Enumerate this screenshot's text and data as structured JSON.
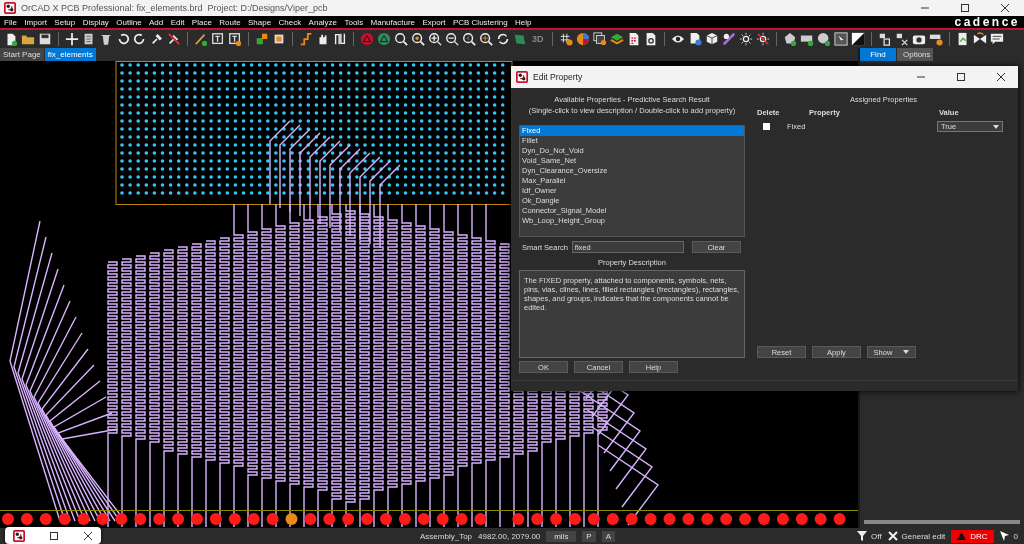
{
  "window": {
    "title": "OrCAD X PCB Professional: fix_elements.brd  Project: D:/Designs/Viper_pcb"
  },
  "menu": [
    "File",
    "Import",
    "Setup",
    "Display",
    "Outline",
    "Add",
    "Edit",
    "Place",
    "Route",
    "Shape",
    "Check",
    "Analyze",
    "Tools",
    "Manufacture",
    "Export",
    "PCB Clustering",
    "Help"
  ],
  "brand": "cadence",
  "toolbar": {
    "view_3d_button": "3D"
  },
  "doc_tabs": [
    {
      "label": "Start Page",
      "selected": false
    },
    {
      "label": "fix_elements",
      "selected": true
    }
  ],
  "side_panel": {
    "tabs": [
      {
        "label": "Find",
        "selected": true
      },
      {
        "label": "Options",
        "selected": false
      }
    ]
  },
  "dialog": {
    "title": "Edit Property",
    "available_heading": "Available Properties - Predictive Search Result",
    "available_hint": "(Single-click to view description / Double-click to add property)",
    "properties": [
      {
        "label": "Fixed",
        "selected": true
      },
      {
        "label": "Fillet",
        "selected": false
      },
      {
        "label": "Dyn_Do_Not_Void",
        "selected": false
      },
      {
        "label": "Void_Same_Net",
        "selected": false
      },
      {
        "label": "Dyn_Clearance_Oversize",
        "selected": false
      },
      {
        "label": "Max_Parallel",
        "selected": false
      },
      {
        "label": "Idf_Owner",
        "selected": false
      },
      {
        "label": "Ok_Dangle",
        "selected": false
      },
      {
        "label": "Connector_Signal_Model",
        "selected": false
      },
      {
        "label": "Wb_Loop_Height_Group",
        "selected": false
      }
    ],
    "smart_search": {
      "label": "Smart Search",
      "value": "fixed"
    },
    "clear_button": "Clear",
    "description_heading": "Property Description",
    "description": "The FIXED property, attached to components, symbols, nets, pins, vias, clines, lines, filled rectangles (frectangles), rectangles, shapes, and groups, indicates that the components cannot be edited.",
    "buttons": [
      "OK",
      "Cancel",
      "Help"
    ],
    "assigned_heading": "Assigned Properties",
    "columns": [
      "Delete",
      "Property",
      "Value"
    ],
    "assigned": [
      {
        "checked": false,
        "property": "Fixed",
        "value": "True"
      }
    ],
    "assigned_buttons": [
      "Reset",
      "Apply"
    ],
    "show_button": "Show"
  },
  "status_bar": {
    "subclass": "Assembly_Top",
    "coordinates": "4982.00, 2079.00",
    "units": "mils",
    "p_button": "P",
    "a_button": "A",
    "filter": "Off",
    "mode": "General edit",
    "drc": "DRC",
    "count": "0"
  }
}
